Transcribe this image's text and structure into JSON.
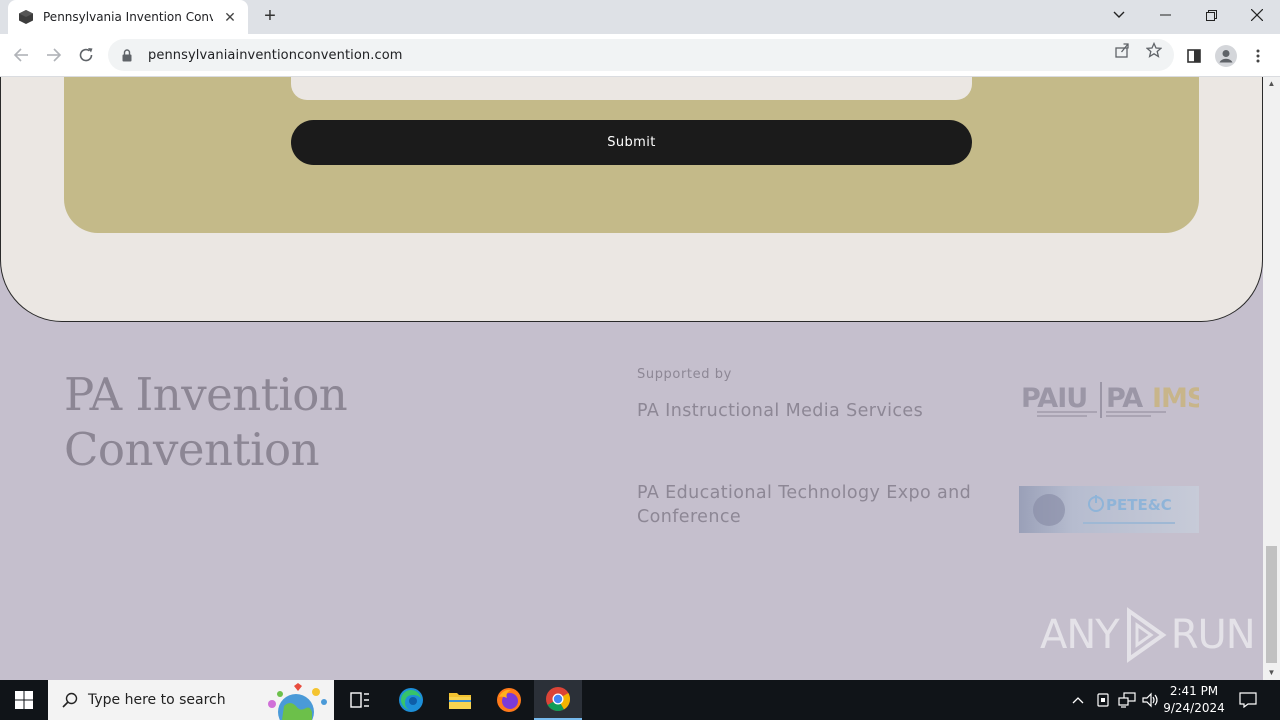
{
  "browser": {
    "tab_title": "Pennsylvania Invention Convent",
    "tab_close": "✕",
    "new_tab": "+",
    "url": "pennsylvaniainventionconvention.com"
  },
  "form": {
    "submit_label": "Submit"
  },
  "footer": {
    "brand_line1": "PA Invention",
    "brand_line2": "Convention",
    "supported_by": "Supported by",
    "sponsors": [
      {
        "name": "PA Instructional Media Services",
        "logo_text": "PAIU|PAIMS"
      },
      {
        "name_line1": "PA Educational Technology Expo and",
        "name_line2": "Conference",
        "logo_text": "PETE&C"
      }
    ]
  },
  "watermark": {
    "left": "ANY",
    "right": "RUN"
  },
  "taskbar": {
    "search_placeholder": "Type here to search",
    "time": "2:41 PM",
    "date": "9/24/2024"
  }
}
